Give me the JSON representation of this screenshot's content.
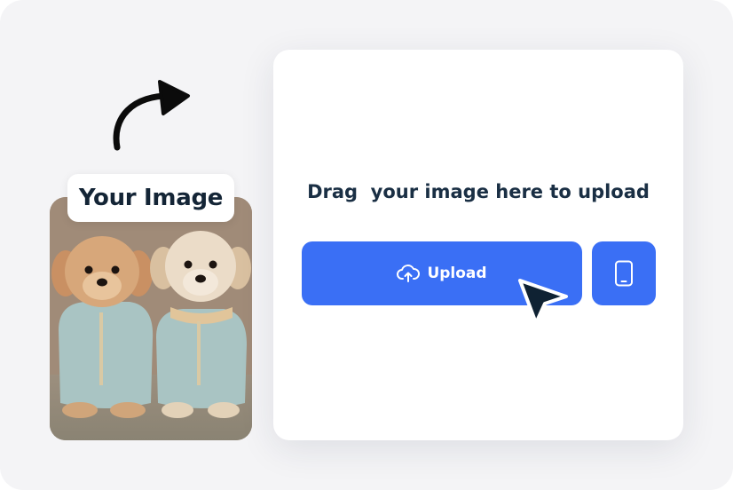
{
  "label": {
    "your_image": "Your Image"
  },
  "upload": {
    "drag_text": "Drag  your image here to upload",
    "upload_label": "Upload"
  },
  "icons": {
    "curved_arrow": "curved-arrow-icon",
    "cloud_upload": "cloud-upload-icon",
    "phone": "smartphone-icon",
    "cursor": "mouse-pointer-icon"
  },
  "colors": {
    "accent": "#3a6ff5",
    "text_dark": "#142536",
    "background": "#f4f4f6"
  }
}
